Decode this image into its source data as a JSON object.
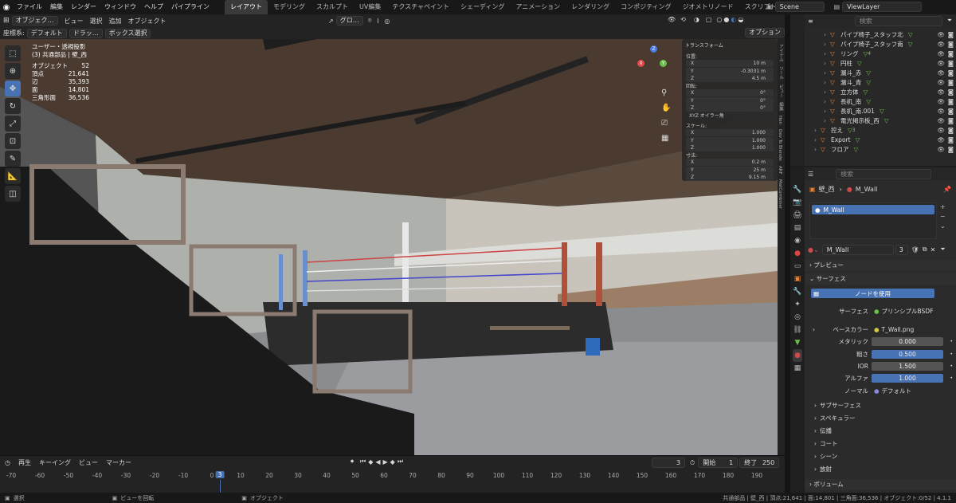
{
  "topbar": {
    "menus": [
      "ファイル",
      "編集",
      "レンダー",
      "ウィンドウ",
      "ヘルプ",
      "パイプライン"
    ],
    "workspaces": [
      "レイアウト",
      "モデリング",
      "スカルプト",
      "UV編集",
      "テクスチャペイント",
      "シェーディング",
      "アニメーション",
      "レンダリング",
      "コンポジティング",
      "ジオメトリノード",
      "スクリプト作成"
    ],
    "active_workspace": "レイアウト",
    "scene": "Scene",
    "viewlayer": "ViewLayer"
  },
  "viewport_header": {
    "mode": "オブジェク…",
    "menus": [
      "ビュー",
      "選択",
      "追加",
      "オブジェクト"
    ],
    "orientation_label": "座標系:",
    "orientation": "デフォルト",
    "drag": "ドラッ…",
    "select": "ボックス選択",
    "transform": "グロ…",
    "options": "オプション"
  },
  "overlay_info": {
    "view": "ユーザー・透視投影",
    "collection": "(3) 共通部品 | 壁_西",
    "stats": [
      {
        "label": "オブジェクト",
        "value": "52"
      },
      {
        "label": "頂点",
        "value": "21,641"
      },
      {
        "label": "辺",
        "value": "35,393"
      },
      {
        "label": "面",
        "value": "14,801"
      },
      {
        "label": "三角形面",
        "value": "36,536"
      }
    ]
  },
  "npanel": {
    "title": "トランスフォーム",
    "location_label": "位置:",
    "location": [
      {
        "axis": "X",
        "value": "10 m"
      },
      {
        "axis": "Y",
        "value": "-0.3031 m"
      },
      {
        "axis": "Z",
        "value": "4.5 m"
      }
    ],
    "rotation_label": "回転:",
    "rotation": [
      {
        "axis": "X",
        "value": "0°"
      },
      {
        "axis": "Y",
        "value": "0°"
      },
      {
        "axis": "Z",
        "value": "0°"
      }
    ],
    "rotation_mode": "XYZ オイラー角",
    "scale_label": "スケール:",
    "scale": [
      {
        "axis": "X",
        "value": "1.000"
      },
      {
        "axis": "Y",
        "value": "1.000"
      },
      {
        "axis": "Z",
        "value": "1.000"
      }
    ],
    "dimensions_label": "寸法:",
    "dimensions": [
      {
        "axis": "X",
        "value": "0.2 m"
      },
      {
        "axis": "Y",
        "value": "25 m"
      },
      {
        "axis": "Z",
        "value": "9.15 m"
      }
    ]
  },
  "side_tabs": [
    "アイテム",
    "ツール",
    "ビュー",
    "編集",
    "Hon",
    "Dev To Blender",
    "ARF",
    "MatCombiner"
  ],
  "timeline": {
    "menus": [
      "再生",
      "キーイング",
      "ビュー",
      "マーカー"
    ],
    "current_frame": "3",
    "start_label": "開始",
    "start": "1",
    "end_label": "終了",
    "end": "250",
    "ticks": [
      "-70",
      "-60",
      "-50",
      "-40",
      "-30",
      "-20",
      "-10",
      "0",
      "10",
      "20",
      "30",
      "40",
      "50",
      "60",
      "70",
      "80",
      "90",
      "100",
      "110",
      "120",
      "130",
      "140",
      "150",
      "160",
      "170",
      "180",
      "190"
    ]
  },
  "statusbar": {
    "left": "選択",
    "mid": "ビューを回転",
    "right": "オブジェクト",
    "stats": "共通部品 | 壁_西 | 頂点:21,641 | 面:14,801 | 三角面:36,536 | オブジェクト:0/52 | 4.1.1"
  },
  "outliner": {
    "search": "検索",
    "items": [
      {
        "name": "パイプ椅子_スタッフ北",
        "indent": 2
      },
      {
        "name": "パイプ椅子_スタッフ南",
        "indent": 2
      },
      {
        "name": "リング",
        "indent": 2,
        "extra": "4"
      },
      {
        "name": "円柱",
        "indent": 2
      },
      {
        "name": "漏斗_赤",
        "indent": 2
      },
      {
        "name": "漏斗_青",
        "indent": 2
      },
      {
        "name": "立方体",
        "indent": 2
      },
      {
        "name": "長机_南",
        "indent": 2
      },
      {
        "name": "長机_南.001",
        "indent": 2
      },
      {
        "name": "電光掲示板_西",
        "indent": 2
      },
      {
        "name": "控え",
        "indent": 1,
        "extra": "3"
      },
      {
        "name": "Export",
        "indent": 1
      },
      {
        "name": "フロア",
        "indent": 1
      }
    ]
  },
  "properties": {
    "search": "検索",
    "breadcrumb_object": "壁_西",
    "breadcrumb_material": "M_Wall",
    "slot": "M_Wall",
    "material_name": "M_Wall",
    "users": "3",
    "sections": {
      "preview": "プレビュー",
      "surface": "サーフェス",
      "use_nodes": "ノードを使用",
      "surface_label": "サーフェス",
      "shader": "プリンシプルBSDF",
      "base_color_label": "ベースカラー",
      "base_color": "T_Wall.png",
      "metallic_label": "メタリック",
      "metallic": "0.000",
      "roughness_label": "粗さ",
      "roughness": "0.500",
      "ior_label": "IOR",
      "ior": "1.500",
      "alpha_label": "アルファ",
      "alpha": "1.000",
      "normal_label": "ノーマル",
      "normal": "デフォルト",
      "collapsed": [
        "サブサーフェス",
        "スペキュラー",
        "伝播",
        "コート",
        "シーン",
        "放射"
      ],
      "volume": "ボリューム"
    }
  },
  "colors": {
    "accent": "#4772b3",
    "bg": "#1d1d1d"
  }
}
